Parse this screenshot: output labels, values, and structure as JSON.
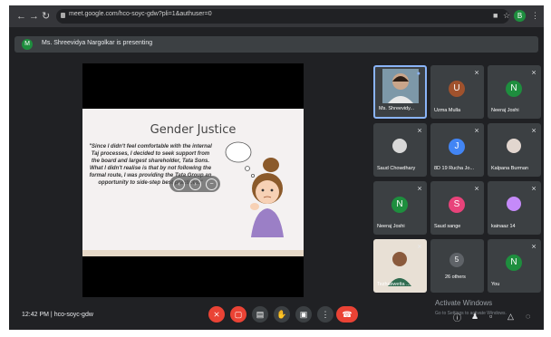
{
  "browser": {
    "url": "meet.google.com/hco-soyc-gdw?pli=1&authuser=0",
    "profile_initial": "B"
  },
  "banner": {
    "initial": "M",
    "text": "Ms. Shreevidya Nargolkar is presenting"
  },
  "slide": {
    "title": "Gender Justice",
    "quote": "\"Since I didn't feel comfortable with the internal Taj processes, I decided to seek support from the board and largest shareholder, Tata Sons. What I didn't realise is that by not following the formal route, I was providing the Tata Group an opportunity to side-step best practices.\""
  },
  "participants": [
    {
      "name": "Ms. Shreevidy...",
      "initial": "",
      "color": "#5f6368",
      "muted": false,
      "active": true
    },
    {
      "name": "Uzma Mulla",
      "initial": "U",
      "color": "#a0522d",
      "muted": true
    },
    {
      "name": "Neeraj Joshi",
      "initial": "N",
      "color": "#1e8e3e",
      "muted": true
    },
    {
      "name": "Saud Chowdhary",
      "initial": "",
      "color": "#cfcfcf",
      "muted": true
    },
    {
      "name": "8D 19 Rucha Jo...",
      "initial": "J",
      "color": "#4285f4",
      "muted": true
    },
    {
      "name": "Kalpana Burman",
      "initial": "",
      "color": "#d9d9d9",
      "muted": true
    },
    {
      "name": "Neeraj Joshi",
      "initial": "N",
      "color": "#1e8e3e",
      "muted": true
    },
    {
      "name": "Saud sange",
      "initial": "S",
      "color": "#e8437a",
      "muted": true
    },
    {
      "name": "kainaaz 14",
      "initial": "",
      "color": "#c58af9",
      "muted": true
    },
    {
      "name": "Tezhaswetta ...",
      "initial": "",
      "color": "#e8e0d5",
      "muted": true
    },
    {
      "name": "26 others",
      "initial": "5",
      "color": "#5f6368",
      "muted": false
    },
    {
      "name": "You",
      "initial": "N",
      "color": "#1e8e3e",
      "muted": true
    }
  ],
  "bottom": {
    "time": "12:42 PM",
    "divider": "|",
    "meeting_code": "hco-soyc-gdw"
  },
  "watermark": {
    "title": "Activate Windows",
    "subtitle": "Go to Settings to activate Windows."
  }
}
